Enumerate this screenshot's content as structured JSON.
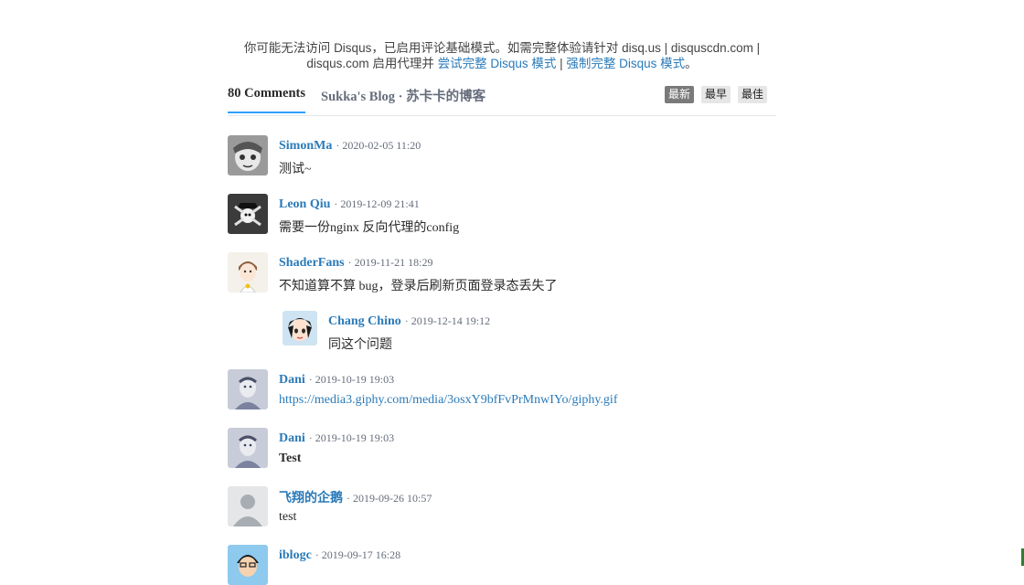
{
  "notice": {
    "line1": "你可能无法访问 Disqus，已启用评论基础模式。如需完整体验请针对 disq.us | disquscdn.com |",
    "line2_prefix": "disqus.com 启用代理并 ",
    "try_link": "尝试完整 Disqus 模式",
    "separator": " | ",
    "force_link": "强制完整 Disqus 模式",
    "line2_suffix": "。"
  },
  "header": {
    "count_label": "80 Comments",
    "forum_label": "Sukka's Blog · 苏卡卡的博客",
    "sort_newest": "最新",
    "sort_oldest": "最早",
    "sort_best": "最佳"
  },
  "comments": [
    {
      "author": "SimonMa",
      "time": "· 2020-02-05 11:20",
      "text": "测试~"
    },
    {
      "author": "Leon Qiu",
      "time": "· 2019-12-09 21:41",
      "text": "需要一份nginx 反向代理的config"
    },
    {
      "author": "ShaderFans",
      "time": "· 2019-11-21 18:29",
      "text": "不知道算不算 bug，登录后刷新页面登录态丢失了"
    },
    {
      "author": "Chang Chino",
      "time": "· 2019-12-14 19:12",
      "text": "同这个问题"
    },
    {
      "author": "Dani",
      "time": "· 2019-10-19 19:03",
      "text": "https://media3.giphy.com/media/3osxY9bfFvPrMnwIYo/giphy.gif"
    },
    {
      "author": "Dani",
      "time": "· 2019-10-19 19:03",
      "text": "Test"
    },
    {
      "author": "飞翔的企鹅",
      "time": "· 2019-09-26 10:57",
      "text": "test"
    },
    {
      "author": "iblogc",
      "time": "· 2019-09-17 16:28",
      "text": ""
    }
  ],
  "colors": {
    "link": "#2a7ab8",
    "accent_underline": "#2e9fff",
    "active_sort_bg": "#7a7a7a"
  }
}
